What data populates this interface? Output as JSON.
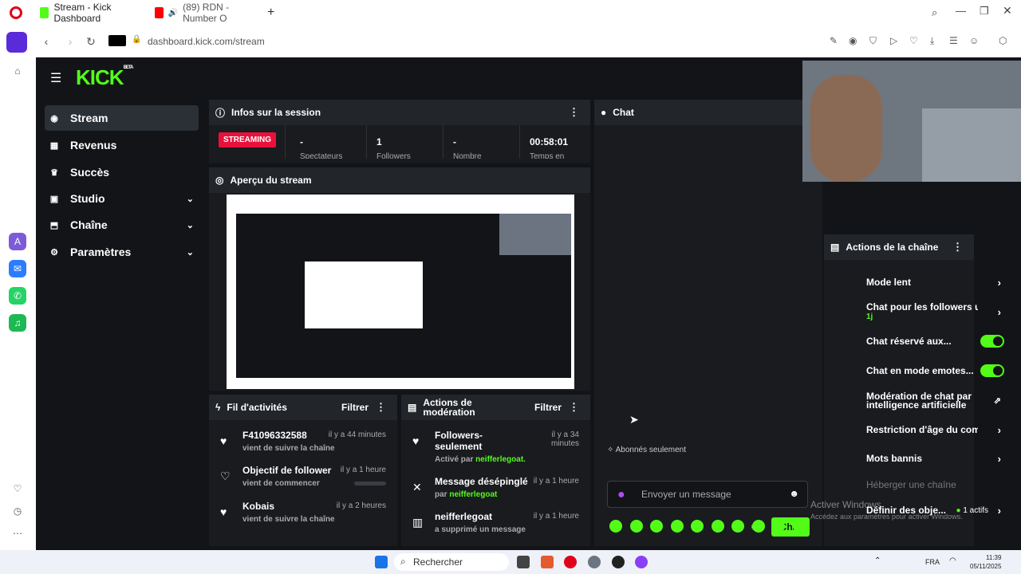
{
  "browser": {
    "tabs": [
      {
        "title": "Stream - Kick Dashboard",
        "icon": "kick-icon",
        "active": true
      },
      {
        "title": "(89) RDN - Number O",
        "icon": "youtube-icon",
        "active": false
      }
    ],
    "new_tab_label": "+",
    "url": "dashboard.kick.com/stream"
  },
  "app": {
    "logo": "KICK",
    "logo_badge": "BETA",
    "sidebar": [
      {
        "label": "Stream",
        "icon": "stream-icon",
        "active": true,
        "chevron": false
      },
      {
        "label": "Revenus",
        "icon": "revenue-icon",
        "active": false,
        "chevron": false
      },
      {
        "label": "Succès",
        "icon": "trophy-icon",
        "active": false,
        "chevron": false
      },
      {
        "label": "Studio",
        "icon": "studio-icon",
        "active": false,
        "chevron": true
      },
      {
        "label": "Chaîne",
        "icon": "channel-icon",
        "active": false,
        "chevron": true
      },
      {
        "label": "Paramètres",
        "icon": "gear-icon",
        "active": false,
        "chevron": true
      }
    ],
    "session": {
      "title": "Infos sur la session",
      "badge": "STREAMING",
      "stats": [
        {
          "value": "-",
          "label": "Spectateurs"
        },
        {
          "value": "1",
          "label": "Followers"
        },
        {
          "value": "-",
          "label": "Nombre"
        },
        {
          "value": "00:58:01",
          "label": "Temps en"
        }
      ]
    },
    "preview": {
      "title": "Aperçu du stream"
    },
    "activity": {
      "title": "Fil d'activités",
      "filter": "Filtrer",
      "items": [
        {
          "name": "F41096332588",
          "sub": "vient de suivre la chaîne",
          "time": "il y a 44 minutes",
          "icon": "heart-icon"
        },
        {
          "name": "Objectif de follower",
          "sub": "vient de commencer",
          "time": "il y a 1 heure",
          "icon": "heart-outline-icon"
        },
        {
          "name": "Kobais",
          "sub": "vient de suivre la chaîne",
          "time": "il y a 2 heures",
          "icon": "heart-icon"
        }
      ]
    },
    "moderation": {
      "title": "Actions de modération",
      "filter": "Filtrer",
      "items": [
        {
          "name": "Followers-seulement",
          "sub_prefix": "Activé par",
          "user": "neifferlegoat.",
          "time": "il y a 34 minutes",
          "icon": "heart-icon"
        },
        {
          "name": "Message désépinglé",
          "sub_prefix": "par",
          "user": "neifferlegoat",
          "time": "il y a 1 heure",
          "icon": "unpin-icon"
        },
        {
          "name": "neifferlegoat",
          "sub_prefix": "a supprimé un message",
          "user": "",
          "time": "il y a 1 heure",
          "icon": "trash-icon"
        }
      ]
    },
    "chat": {
      "title": "Chat",
      "mode_label": "Abonnés seulement",
      "input_placeholder": "Envoyer un message",
      "send_label": "Chat"
    },
    "channel_actions": {
      "title": "Actions de la chaîne",
      "items": [
        {
          "label": "Mode lent",
          "control": "arrow"
        },
        {
          "label": "Chat pour les followers uni",
          "sub": "1j",
          "control": "arrow"
        },
        {
          "label": "Chat réservé aux...",
          "control": "toggle"
        },
        {
          "label": "Chat en mode emotes...",
          "control": "toggle"
        },
        {
          "label": "Modération de chat par intelligence artificielle",
          "control": "external"
        },
        {
          "label": "Restriction d'âge du compt",
          "control": "arrow"
        },
        {
          "label": "Mots bannis",
          "control": "arrow"
        },
        {
          "label": "Héberger une chaîne",
          "control": "none"
        },
        {
          "label": "Définir des obje...",
          "badge": "1 actifs",
          "control": "arrow"
        }
      ]
    },
    "watermark": {
      "line1": "Activer Windows",
      "line2": "Accédez aux paramètres pour activer Windows."
    }
  },
  "taskbar": {
    "search": "Rechercher",
    "lang": "FRA",
    "time": "11:39",
    "date": "05/11/2025"
  },
  "colors": {
    "accent": "#53fc18",
    "live": "#e9113c",
    "bg": "#121417"
  }
}
